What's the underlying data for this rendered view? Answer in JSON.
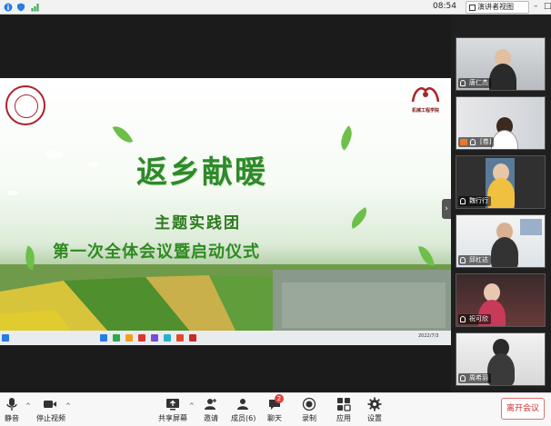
{
  "topbar": {
    "time": "08:54",
    "view_button_label": "演讲者视图"
  },
  "slide": {
    "title_main": "返乡献暖",
    "title_sub": "主题实践团",
    "title_event": "第一次全体会议暨启动仪式",
    "school_label": "机械工程学院",
    "logo_year": "1951",
    "taskbar_clock": "2022/7/3"
  },
  "participants": [
    {
      "name": "唐仁杰"
    },
    {
      "name": "[卷]"
    },
    {
      "name": "魏行行"
    },
    {
      "name": "邱杠达"
    },
    {
      "name": "祝可欣"
    },
    {
      "name": "周希羽"
    }
  ],
  "toolbar": {
    "mute_label": "静音",
    "video_label": "停止视频",
    "share_label": "共享屏幕",
    "invite_label": "邀请",
    "members_label": "成员(6)",
    "chat_label": "聊天",
    "chat_badge": "2",
    "record_label": "录制",
    "apps_label": "应用",
    "settings_label": "设置",
    "leave_label": "离开会议"
  },
  "colors": {
    "accent_green": "#2e8a2a",
    "leave_red": "#d03030"
  }
}
